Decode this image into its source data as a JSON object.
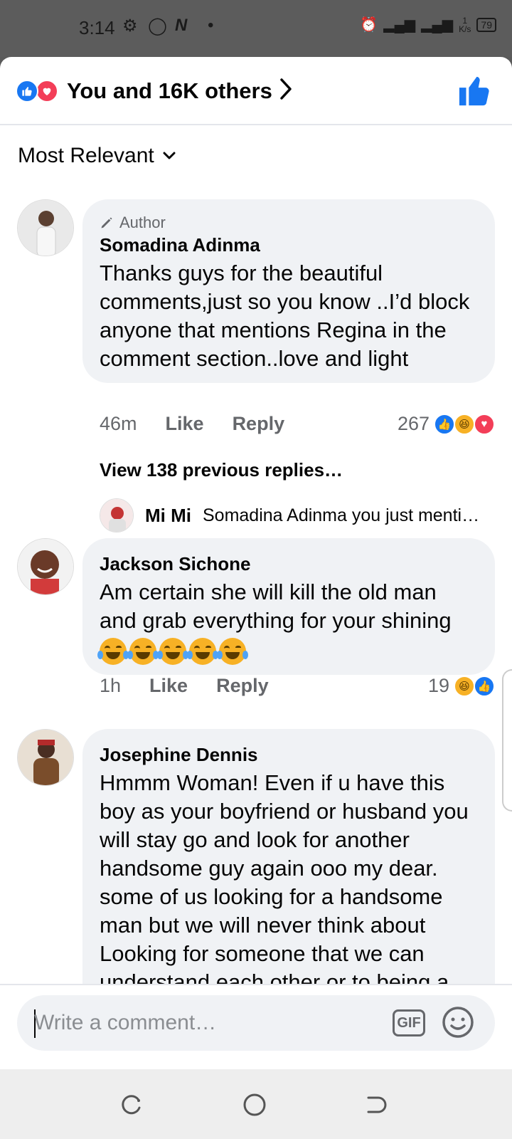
{
  "status_bar": {
    "time": "3:14",
    "network_speed": "1\nK/s",
    "battery": "79",
    "icons": [
      "gear-icon",
      "whatsapp-icon",
      "n-icon",
      "dot-icon",
      "alarm-icon",
      "signal-icon",
      "signal-icon",
      "battery-icon"
    ]
  },
  "reactions_header": {
    "summary": "You and 16K others",
    "icons": [
      "like-reaction-icon",
      "love-reaction-icon"
    ]
  },
  "sort": {
    "label": "Most Relevant"
  },
  "comments": [
    {
      "badge": "Author",
      "name": "Somadina Adinma",
      "text": "Thanks guys for the beautiful comments,just so you know ..I’d block anyone that mentions Regina in the comment section..love and light",
      "time": "46m",
      "like_label": "Like",
      "reply_label": "Reply",
      "reaction_count": "267",
      "reactions": [
        "like",
        "haha",
        "love"
      ]
    },
    {
      "name": "Jackson Sichone",
      "text": "Am certain she will kill the old man and grab everything for your shining",
      "emoji_count": 5,
      "time": "1h",
      "like_label": "Like",
      "reply_label": "Reply",
      "reaction_count": "19",
      "reactions": [
        "haha",
        "like"
      ]
    },
    {
      "name": "Josephine Dennis",
      "text": "Hmmm Woman! Even if u have this boy as your boyfriend  or  husband you will stay go and look for another handsome guy again ooo my dear. some of us looking for a handsome man but we will never think about Looking for someone that we can understand each other or to being a"
    }
  ],
  "replies": {
    "view_previous": "View 138 previous replies…",
    "latest": {
      "name": "Mi Mi",
      "text": "Somadina Adinma  you just menti…"
    }
  },
  "composer": {
    "placeholder": "Write a comment…",
    "gif_label": "GIF"
  },
  "colors": {
    "accent": "#1877f2",
    "love": "#f33e58",
    "haha": "#f7b125",
    "bubble": "#f0f2f5",
    "secondary_text": "#65676b"
  }
}
